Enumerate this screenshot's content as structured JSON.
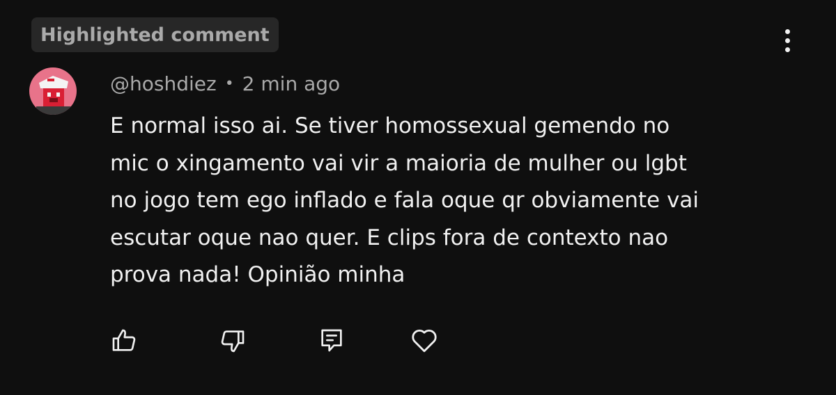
{
  "highlight_chip": {
    "label": "Highlighted comment"
  },
  "comment": {
    "author": "@hoshdiez",
    "separator": "•",
    "timestamp": "2 min ago",
    "text": "E normal isso ai. Se tiver homossexual gemendo no\nmic o xingamento vai vir a maioria de mulher ou lgbt\nno jogo tem ego inflado e fala oque qr obviamente vai\nescutar oque nao quer. E clips fora de contexto nao\nprova nada! Opinião minha",
    "avatar": {
      "name": "avatar-red-creeper-character",
      "background": "#e8738a",
      "face_color": "#d91f34",
      "cap_color": "#f4f4f4"
    }
  },
  "actions": [
    {
      "name": "like-icon"
    },
    {
      "name": "dislike-icon"
    },
    {
      "name": "reply-icon"
    },
    {
      "name": "heart-icon"
    }
  ],
  "menu": {
    "icon": "more-vertical-icon"
  },
  "colors": {
    "background": "#0f0f0f",
    "chip_background": "#272727",
    "secondary_text": "#aaaaaa",
    "primary_text": "#f1f1f1"
  }
}
